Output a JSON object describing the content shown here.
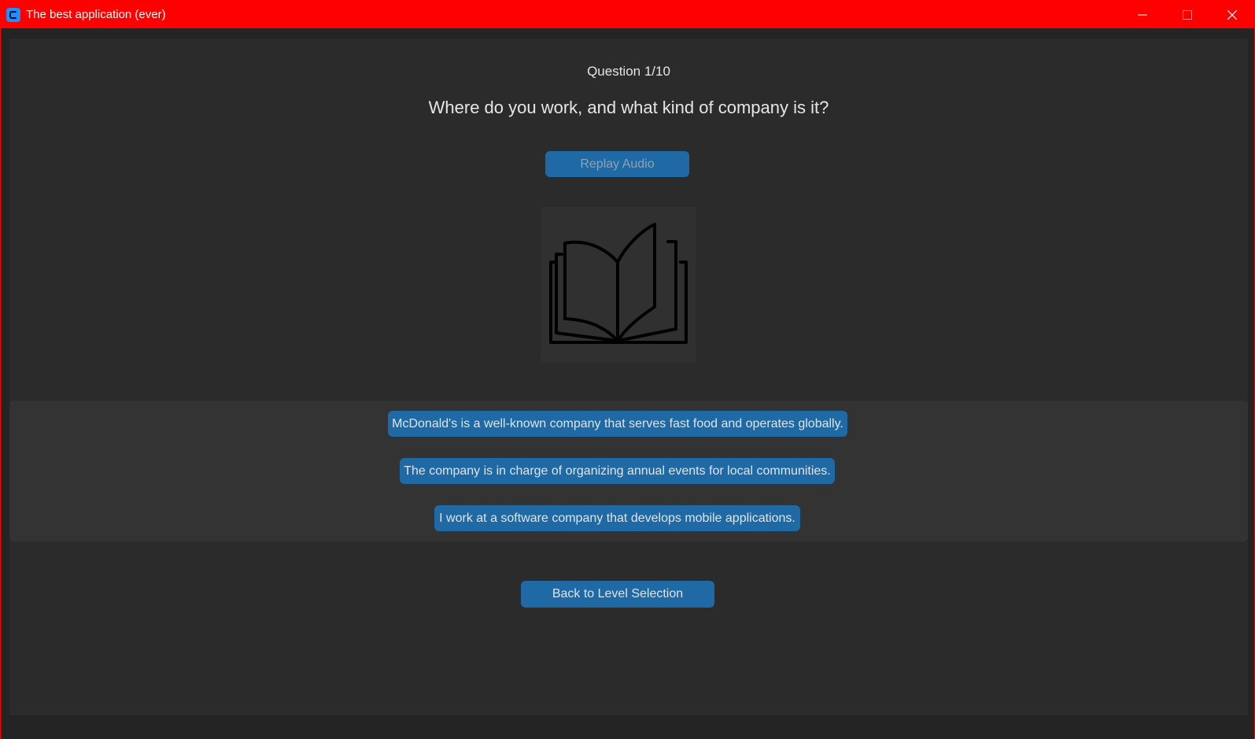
{
  "window": {
    "title": "The best application (ever)",
    "controls": {
      "minimize_icon": "minimize-icon",
      "maximize_icon": "maximize-icon",
      "close_icon": "close-icon"
    },
    "titlebar_color": "#ff0000"
  },
  "quiz": {
    "progress": "Question 1/10",
    "question": "Where do you work, and what kind of company is it?",
    "replay_label": "Replay Audio",
    "image_icon": "open-book-icon",
    "answers": [
      "McDonald's is a well-known company that serves fast food and operates globally.",
      "The company is in charge of organizing annual events for local communities.",
      "I work at a software company that develops mobile applications."
    ],
    "back_label": "Back to Level Selection"
  },
  "colors": {
    "button": "#1f6aa5",
    "background": "#2b2b2b",
    "answers_panel": "#333333",
    "text": "#dce4ee"
  }
}
